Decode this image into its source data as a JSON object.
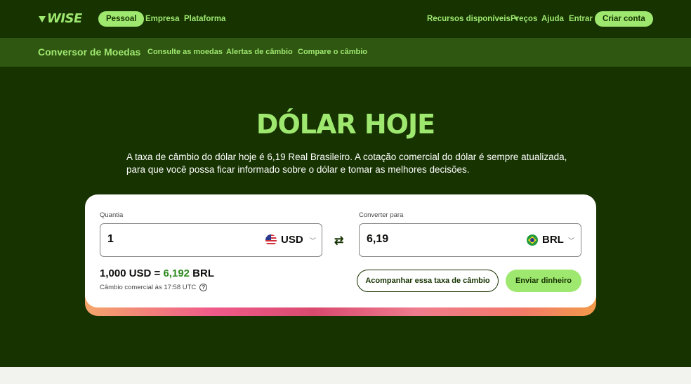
{
  "brand": {
    "logo_text": "WISE",
    "accent": "#9fe870",
    "dark": "#163300"
  },
  "topnav": {
    "left": [
      "Pessoal",
      "Empresa",
      "Plataforma"
    ],
    "resources_label": "Recursos disponíveis",
    "right": [
      "Preços",
      "Ajuda",
      "Entrar"
    ],
    "cta_label": "Criar conta"
  },
  "subnav": {
    "title": "Conversor de Moedas",
    "links": [
      "Consulte as moedas",
      "Alertas de câmbio",
      "Compare o câmbio"
    ]
  },
  "hero": {
    "title": "DÓLAR HOJE",
    "description": "A taxa de câmbio do dólar hoje é 6,19 Real Brasileiro. A cotação comercial do dólar é sempre atualizada, para que você possa ficar informado sobre o dólar e tomar as melhores decisões."
  },
  "converter": {
    "amount_label": "Quantia",
    "amount_value": "1",
    "from_currency": "USD",
    "to_label": "Converter para",
    "to_value": "6,19",
    "to_currency": "BRL",
    "rate_prefix": "1,000 USD = ",
    "rate_value": "6,192",
    "rate_suffix": " BRL",
    "rate_note": "Câmbio comercial às 17:58 UTC",
    "track_button": "Acompanhar essa taxa de câmbio",
    "send_button": "Enviar dinheiro"
  }
}
